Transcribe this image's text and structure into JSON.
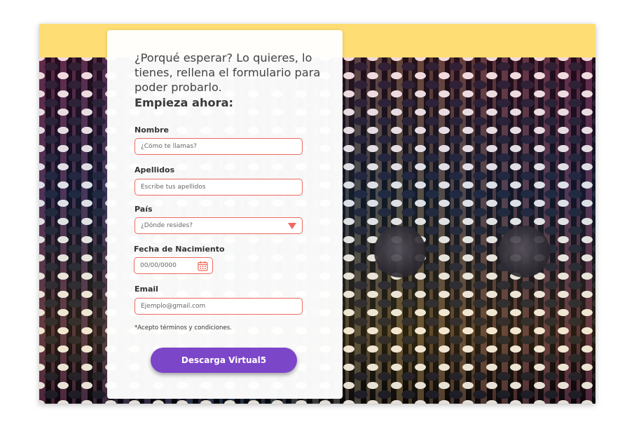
{
  "colors": {
    "header_yellow": "#fedd74",
    "field_border": "#ee6a5e",
    "button_purple": "#7c46c9"
  },
  "form": {
    "intro_text": "¿Porqué esperar? Lo quieres, lo tienes, rellena el formulario para poder probarlo.",
    "intro_strong": "Empieza ahora:",
    "fields": {
      "nombre": {
        "label": "Nombre",
        "placeholder": "¿Cómo te llamas?"
      },
      "apellidos": {
        "label": "Apellidos",
        "placeholder": "Escribe tus apellidos"
      },
      "pais": {
        "label": "País",
        "selected": "¿Dónde resides?",
        "icon": "caret-down-icon"
      },
      "fecha": {
        "label": "Fecha de Nacimiento",
        "placeholder": "00/00/0000",
        "icon": "calendar-icon"
      },
      "email": {
        "label": "Email",
        "placeholder": "Ejemplo@gmail.com"
      }
    },
    "terms": "*Acepto términos y condiciones.",
    "submit_label": "Descarga Virtual5"
  }
}
